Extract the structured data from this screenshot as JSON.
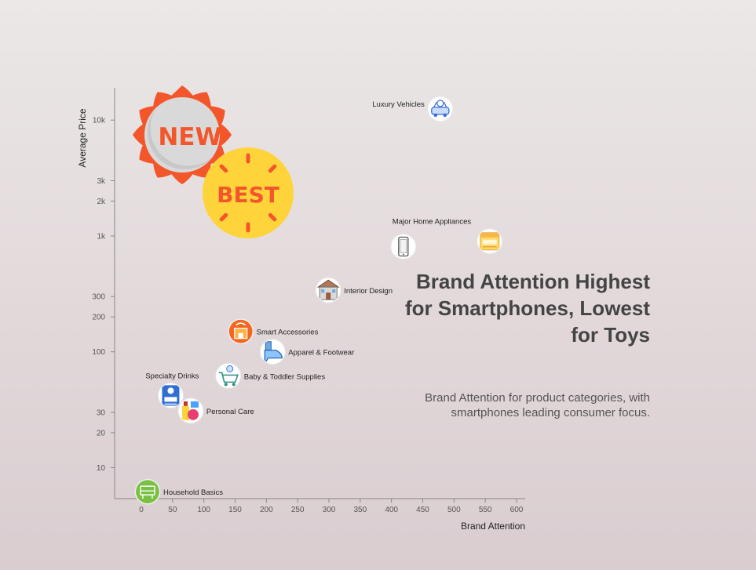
{
  "headline": "Brand Attention Highest for Smartphones, Lowest for Toys",
  "subheadline": "Brand Attention for product categories, with smartphones leading consumer focus.",
  "badges": {
    "new": "NEW",
    "best": "BEST"
  },
  "colors": {
    "axis": "#888888",
    "badge_new": "#f4562b",
    "badge_best": "#ffd43b",
    "badge_text": "#f4562b"
  },
  "chart_data": {
    "type": "scatter",
    "xlabel": "Brand Attention",
    "ylabel": "Average Price",
    "x_scale": "linear",
    "y_scale": "log",
    "xlim": [
      -10,
      612
    ],
    "ylim": [
      5.4,
      19000
    ],
    "x_ticks": [
      0,
      50,
      100,
      150,
      200,
      250,
      300,
      350,
      400,
      450,
      500,
      550,
      600
    ],
    "y_ticks": [
      {
        "value": 10,
        "label": "10"
      },
      {
        "value": 20,
        "label": "20"
      },
      {
        "value": 30,
        "label": "30"
      },
      {
        "value": 100,
        "label": "100"
      },
      {
        "value": 200,
        "label": "200"
      },
      {
        "value": 300,
        "label": "300"
      },
      {
        "value": 1000,
        "label": "1k"
      },
      {
        "value": 2000,
        "label": "2k"
      },
      {
        "value": 3000,
        "label": "3k"
      },
      {
        "value": 10000,
        "label": "10k"
      }
    ],
    "points": [
      {
        "label": "Luxury Vehicles",
        "x": 478,
        "y": 12500,
        "icon": "car-icon"
      },
      {
        "label": "",
        "x": 557,
        "y": 900,
        "icon": "appliance-icon"
      },
      {
        "label": "Major Home Appliances",
        "x": 419,
        "y": 810,
        "icon": "smartphone-icon"
      },
      {
        "label": "Interior Design",
        "x": 299,
        "y": 340,
        "icon": "house-icon"
      },
      {
        "label": "Smart Accessories",
        "x": 159,
        "y": 150,
        "icon": "smart-device-icon"
      },
      {
        "label": "Apparel & Footwear",
        "x": 210,
        "y": 100,
        "icon": "shoe-icon"
      },
      {
        "label": "Baby & Toddler Supplies",
        "x": 139,
        "y": 62,
        "icon": "cart-icon"
      },
      {
        "label": "Specialty Drinks",
        "x": 47,
        "y": 42,
        "icon": "coffee-machine-icon"
      },
      {
        "label": "Personal Care",
        "x": 79,
        "y": 31,
        "icon": "cosmetics-icon"
      },
      {
        "label": "Household Basics",
        "x": 10,
        "y": 6.2,
        "icon": "household-icon"
      }
    ]
  }
}
